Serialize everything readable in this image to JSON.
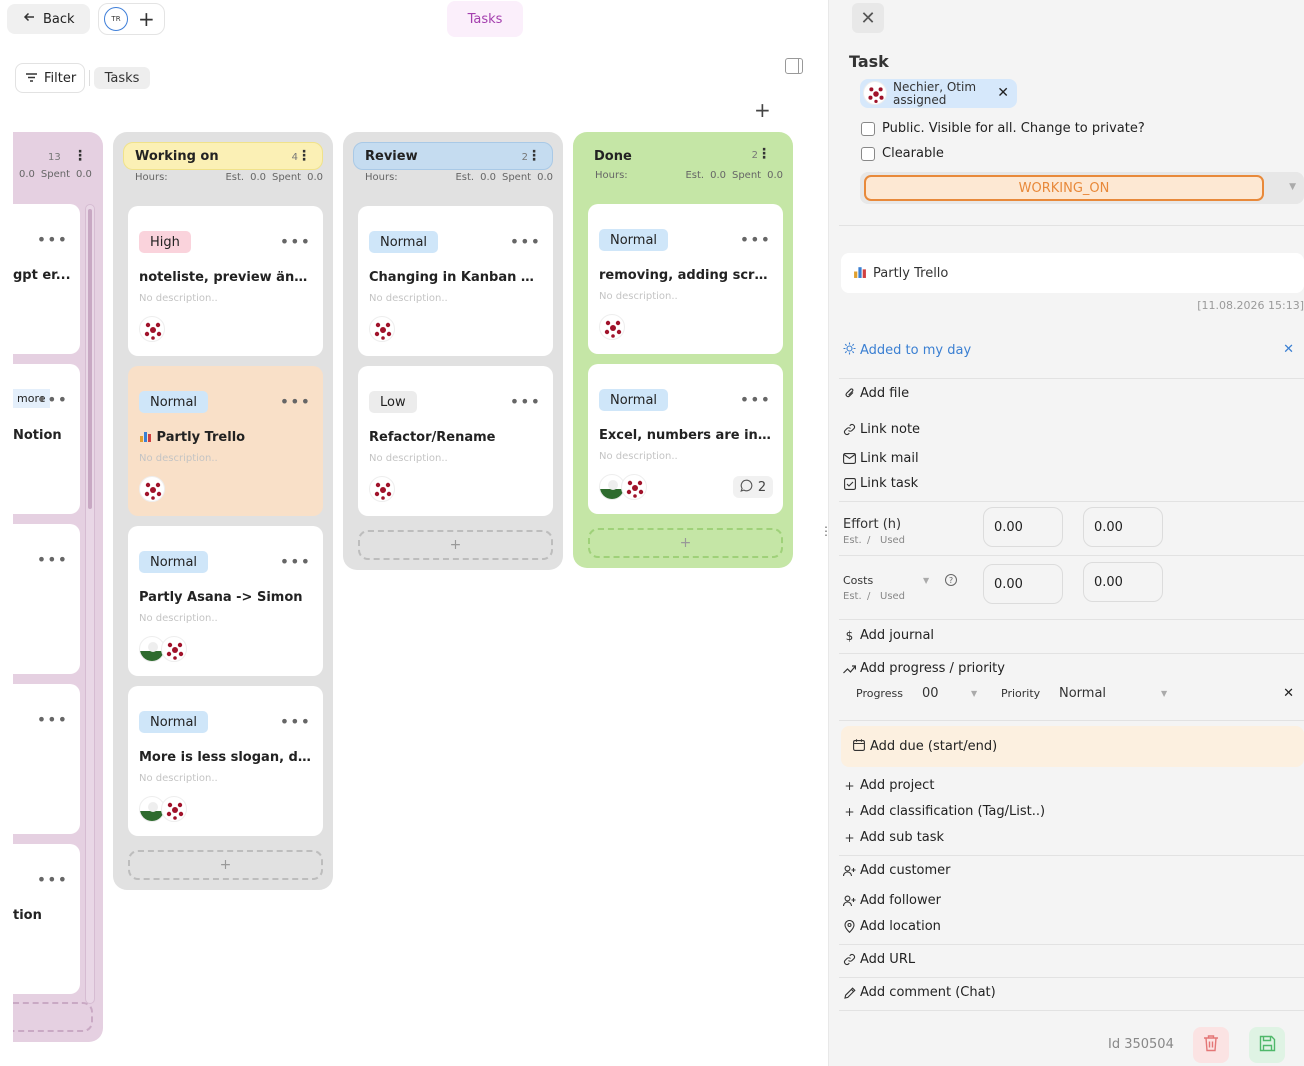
{
  "topbar": {
    "back_label": "Back",
    "avatar_initials": "TR",
    "add_glyph": "+",
    "title": "Tasks"
  },
  "toolbar": {
    "filter_label": "Filter",
    "view_chip": "Tasks",
    "add_column_glyph": "+"
  },
  "left_column": {
    "count": "13",
    "hours_est": "0.0",
    "spent_label": "Spent",
    "hours_spent": "0.0",
    "cards": [
      {
        "title": "gpt er..."
      },
      {
        "tag": "more",
        "title": "Notion"
      },
      {
        "title": ""
      },
      {
        "title": ""
      },
      {
        "title": "tion"
      }
    ]
  },
  "columns": [
    {
      "name": "Working on",
      "count": "4",
      "hours_label": "Hours:",
      "est_label": "Est.",
      "est": "0.0",
      "spent_label": "Spent",
      "spent": "0.0",
      "cards": [
        {
          "priority": "High",
          "title": "noteliste, preview änder...",
          "desc": "No description..",
          "icon": ""
        },
        {
          "priority": "Normal",
          "title": "Partly Trello",
          "desc": "No description..",
          "icon": "chart-icon"
        },
        {
          "priority": "Normal",
          "title": "Partly Asana -> Simon",
          "desc": "No description..",
          "icon": ""
        },
        {
          "priority": "Normal",
          "title": "More is less slogan, deep...",
          "desc": "No description..",
          "icon": ""
        }
      ],
      "add_glyph": "+"
    },
    {
      "name": "Review",
      "count": "2",
      "hours_label": "Hours:",
      "est_label": "Est.",
      "est": "0.0",
      "spent_label": "Spent",
      "spent": "0.0",
      "cards": [
        {
          "priority": "Normal",
          "title": "Changing in Kanban doe...",
          "desc": "No description..",
          "icon": ""
        },
        {
          "priority": "Low",
          "title": "Refactor/Rename",
          "desc": "No description..",
          "icon": ""
        }
      ],
      "add_glyph": "+"
    },
    {
      "name": "Done",
      "count": "2",
      "hours_label": "Hours:",
      "est_label": "Est.",
      "est": "0.0",
      "spent_label": "Spent",
      "spent": "0.0",
      "cards": [
        {
          "priority": "Normal",
          "title": "removing, adding scrolls...",
          "desc": "No description..",
          "icon": ""
        },
        {
          "priority": "Normal",
          "title": "Excel, numbers are incre...",
          "desc": "No description..",
          "icon": "",
          "comments": "2"
        }
      ],
      "add_glyph": "+"
    }
  ],
  "detail": {
    "title": "Task",
    "assignee_name": "Nechier, Otim",
    "assignee_role": "assigned",
    "public_label": "Public. Visible for all. Change to private?",
    "clearable_label": "Clearable",
    "status": "WORKING_ON",
    "task_title": "Partly Trello",
    "timestamp": "[11.08.2026 15:13]",
    "my_day": "Added to my day",
    "add_file": "Add file",
    "link_note": "Link note",
    "link_mail": "Link mail",
    "link_task": "Link task",
    "effort_label": "Effort (h)",
    "est_label": "Est.",
    "slash": "/",
    "used_label": "Used",
    "effort_est": "0.00",
    "effort_used": "0.00",
    "costs_label": "Costs",
    "costs_est": "0.00",
    "costs_used": "0.00",
    "add_journal": "Add journal",
    "add_progress": "Add progress / priority",
    "progress_label": "Progress",
    "progress_value": "00",
    "priority_label": "Priority",
    "priority_value": "Normal",
    "add_due": "Add due (start/end)",
    "add_project": "Add project",
    "add_classification": "Add classification (Tag/List..)",
    "add_sub_task": "Add sub task",
    "add_customer": "Add customer",
    "add_follower": "Add follower",
    "add_location": "Add location",
    "add_url": "Add URL",
    "add_comment": "Add comment (Chat)",
    "id_text": "Id 350504"
  },
  "colors": {
    "working_on_bg": "#e1e1e1",
    "review_bg": "#e1e1e1",
    "done_bg": "#c5e6a6",
    "accent_blue": "#3a7fd2",
    "status_orange": "#e8893a"
  }
}
